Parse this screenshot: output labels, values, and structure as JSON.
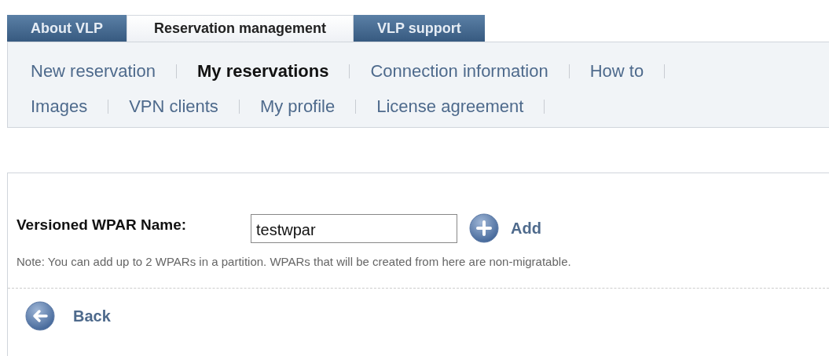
{
  "tabs": [
    {
      "label": "About VLP",
      "selected": false
    },
    {
      "label": "Reservation management",
      "selected": true
    },
    {
      "label": "VLP support",
      "selected": false
    }
  ],
  "submenu": [
    [
      {
        "label": "New reservation",
        "selected": false
      },
      {
        "label": "My reservations",
        "selected": true
      },
      {
        "label": "Connection information",
        "selected": false
      },
      {
        "label": "How to",
        "selected": false
      }
    ],
    [
      {
        "label": "Images",
        "selected": false
      },
      {
        "label": "VPN clients",
        "selected": false
      },
      {
        "label": "My profile",
        "selected": false
      },
      {
        "label": "License agreement",
        "selected": false
      }
    ]
  ],
  "form": {
    "label": "Versioned WPAR Name:",
    "value": "testwpar",
    "add": "Add",
    "note": "Note: You can add up to 2 WPARs in a partition. WPARs that will be created from here are non-migratable."
  },
  "back": "Back"
}
